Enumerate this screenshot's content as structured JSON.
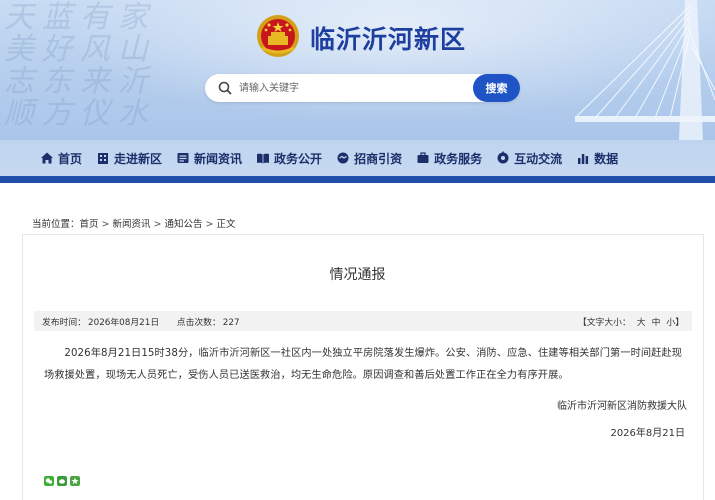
{
  "header": {
    "site_title": "临沂沂河新区",
    "calligraphy": "天蓝有家 美好风山 志东来沂 顺方仪水"
  },
  "search": {
    "placeholder": "请输入关键字",
    "button_label": "搜索"
  },
  "nav": {
    "items": [
      {
        "label": "首页",
        "icon": "home-icon"
      },
      {
        "label": "走进新区",
        "icon": "building-icon"
      },
      {
        "label": "新闻资讯",
        "icon": "news-icon"
      },
      {
        "label": "政务公开",
        "icon": "book-icon"
      },
      {
        "label": "招商引资",
        "icon": "handshake-icon"
      },
      {
        "label": "政务服务",
        "icon": "briefcase-icon"
      },
      {
        "label": "互动交流",
        "icon": "chat-icon"
      },
      {
        "label": "数据",
        "icon": "bar-chart-icon"
      }
    ]
  },
  "breadcrumb": {
    "label": "当前位置：",
    "items": [
      "首页",
      "新闻资讯",
      "通知公告",
      "正文"
    ],
    "separator": ">"
  },
  "article": {
    "title": "情况通报",
    "meta": {
      "publish_label": "发布时间：",
      "publish_date": "2026年08月21日",
      "clicks_label": "点击次数：",
      "clicks": "227",
      "font_size_label": "【文字大小：",
      "size_large": "大",
      "size_medium": "中",
      "size_small": "小",
      "font_size_close": "】"
    },
    "body": "2026年8月21日15时38分，临沂市沂河新区一社区内一处独立平房院落发生爆炸。公安、消防、应急、住建等相关部门第一时间赶赴现场救援处置，现场无人员死亡，受伤人员已送医救治，均无生命危险。原因调查和善后处置工作正在全力有序开展。",
    "sign_org": "临沂市沂河新区消防救援大队",
    "sign_date": "2026年8月21日"
  },
  "colors": {
    "brand_blue": "#1f54c7",
    "nav_bar": "#1f4fa8",
    "title_blue": "#1e3fa0"
  }
}
